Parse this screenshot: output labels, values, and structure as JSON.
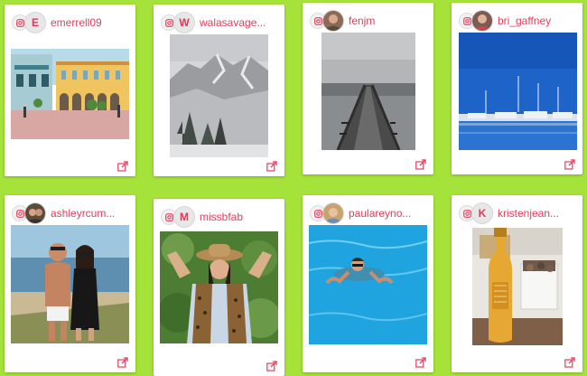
{
  "posts": [
    {
      "username": "emerrell09",
      "avatar_letter": "E",
      "avatar_type": "letter",
      "photo": "colorful-town-square-photo"
    },
    {
      "username": "walasavage...",
      "avatar_letter": "W",
      "avatar_type": "letter",
      "photo": "snowy-mountain-photo"
    },
    {
      "username": "fenjm",
      "avatar_letter": "",
      "avatar_type": "photo",
      "photo": "wooden-pier-photo"
    },
    {
      "username": "bri_gaffney",
      "avatar_letter": "",
      "avatar_type": "photo",
      "photo": "marina-boats-photo"
    },
    {
      "username": "ashleyrcum...",
      "avatar_letter": "",
      "avatar_type": "photo",
      "photo": "couple-on-beach-photo"
    },
    {
      "username": "missbfab",
      "avatar_letter": "M",
      "avatar_type": "letter",
      "photo": "woman-with-hat-photo"
    },
    {
      "username": "paulareyno...",
      "avatar_letter": "",
      "avatar_type": "photo",
      "photo": "swimming-pool-photo"
    },
    {
      "username": "kristenjean...",
      "avatar_letter": "K",
      "avatar_type": "letter",
      "photo": "bottle-and-boxes-photo"
    }
  ],
  "colors": {
    "background": "#a6e33a",
    "username": "#e23e5d",
    "card": "#ffffff"
  },
  "icons": {
    "source": "instagram-icon",
    "share": "share-icon"
  }
}
